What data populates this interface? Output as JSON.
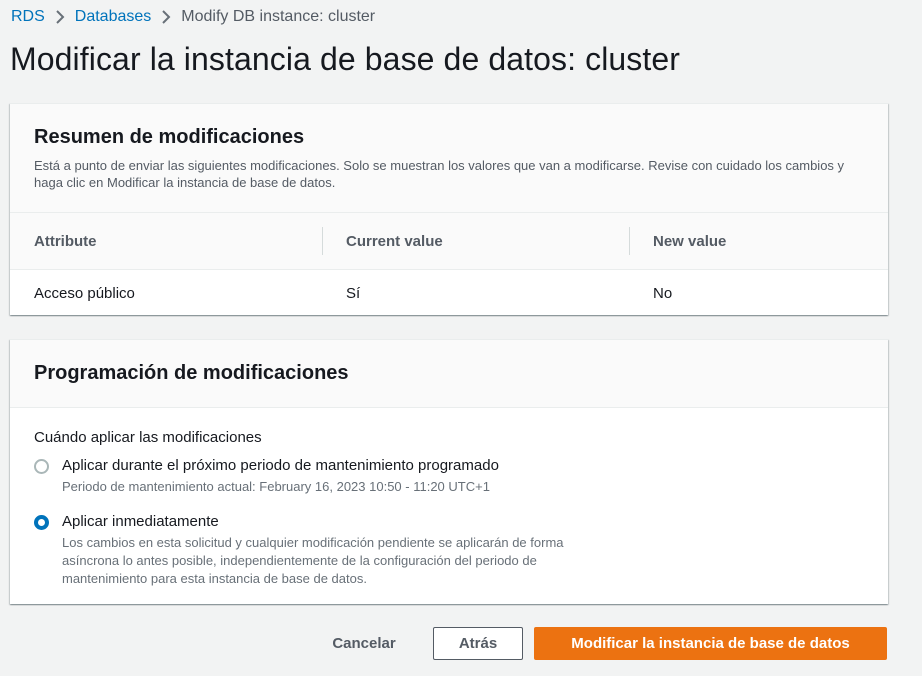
{
  "breadcrumb": {
    "items": [
      "RDS",
      "Databases",
      "Modify DB instance: cluster"
    ]
  },
  "page": {
    "title": "Modificar la instancia de base de datos: cluster"
  },
  "summary": {
    "title": "Resumen de modificaciones",
    "description": "Está a punto de enviar las siguientes modificaciones. Solo se muestran los valores que van a modificarse. Revise con cuidado los cambios y haga clic en Modificar la instancia de base de datos.",
    "columns": [
      "Attribute",
      "Current value",
      "New value"
    ],
    "rows": [
      [
        "Acceso público",
        "Sí",
        "No"
      ]
    ]
  },
  "schedule": {
    "title": "Programación de modificaciones",
    "field_label": "Cuándo aplicar las modificaciones",
    "options": [
      {
        "label": "Aplicar durante el próximo periodo de mantenimiento programado",
        "description": "Periodo de mantenimiento actual: February 16, 2023 10:50 - 11:20 UTC+1",
        "selected": false
      },
      {
        "label": "Aplicar inmediatamente",
        "description": "Los cambios en esta solicitud y cualquier modificación pendiente se aplicarán de forma asíncrona lo antes posible, independientemente de la configuración del periodo de mantenimiento para esta instancia de base de datos.",
        "selected": true
      }
    ]
  },
  "actions": {
    "cancel_label": "Cancelar",
    "back_label": "Atrás",
    "submit_label": "Modificar la instancia de base de datos"
  },
  "colors": {
    "link": "#0073bb",
    "primary_button": "#ec7211",
    "radio_selected": "#0073bb"
  }
}
